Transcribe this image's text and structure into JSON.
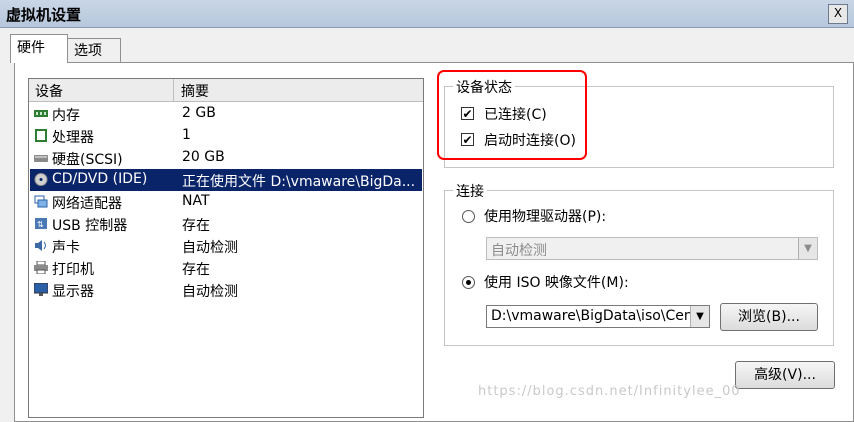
{
  "window": {
    "title": "虚拟机设置",
    "close_glyph": "X"
  },
  "tabs": [
    {
      "label": "硬件",
      "active": true
    },
    {
      "label": "选项",
      "active": false
    }
  ],
  "device_list": {
    "columns": [
      "设备",
      "摘要"
    ],
    "rows": [
      {
        "name": "内存",
        "summary": "2 GB",
        "icon": "memory-icon"
      },
      {
        "name": "处理器",
        "summary": "1",
        "icon": "processor-icon"
      },
      {
        "name": "硬盘(SCSI)",
        "summary": "20 GB",
        "icon": "harddisk-icon"
      },
      {
        "name": "CD/DVD (IDE)",
        "summary": "正在使用文件 D:\\vmaware\\BigDa...",
        "icon": "cd-dvd-icon",
        "selected": true
      },
      {
        "name": "网络适配器",
        "summary": "NAT",
        "icon": "network-adapter-icon"
      },
      {
        "name": "USB 控制器",
        "summary": "存在",
        "icon": "usb-icon"
      },
      {
        "name": "声卡",
        "summary": "自动检测",
        "icon": "sound-icon"
      },
      {
        "name": "打印机",
        "summary": "存在",
        "icon": "printer-icon"
      },
      {
        "name": "显示器",
        "summary": "自动检测",
        "icon": "display-icon"
      }
    ]
  },
  "device_status": {
    "legend": "设备状态",
    "connected": {
      "label": "已连接(C)",
      "checked": true
    },
    "connect_on_power_on": {
      "label": "启动时连接(O)",
      "checked": true
    }
  },
  "connection": {
    "legend": "连接",
    "physical_drive": {
      "label": "使用物理驱动器(P):",
      "selected": false,
      "value": "自动检测"
    },
    "iso_image": {
      "label": "使用 ISO 映像文件(M):",
      "selected": true,
      "value": "D:\\vmaware\\BigData\\iso\\Cent"
    },
    "browse_label": "浏览(B)..."
  },
  "advanced_label": "高级(V)...",
  "watermark": "https://blog.csdn.net/Infinitylee_00",
  "colors": {
    "selection": "#0a246a",
    "highlight_box": "#ff0000"
  }
}
